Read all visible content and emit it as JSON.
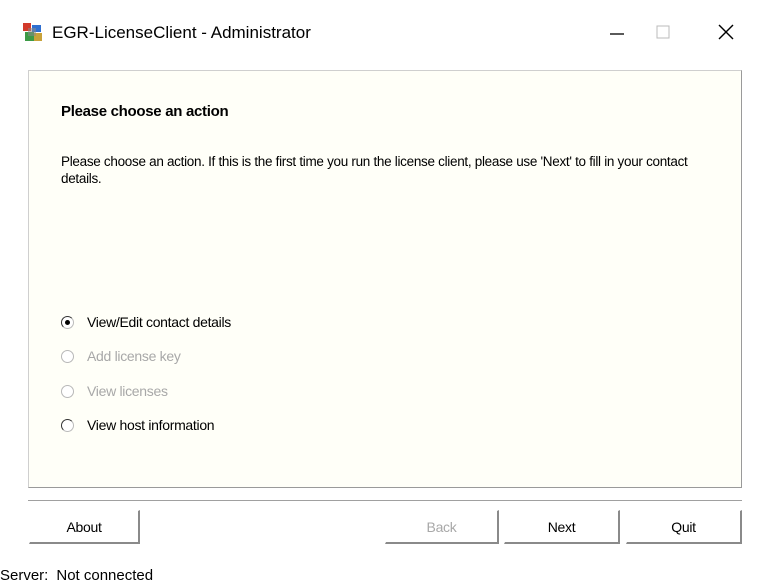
{
  "window": {
    "title": "EGR-LicenseClient - Administrator",
    "app_icon": "egr-license-client-icon",
    "controls": {
      "minimize": "minimize-icon",
      "maximize": "maximize-icon",
      "close": "close-icon"
    }
  },
  "panel": {
    "heading": "Please choose an action",
    "description": "Please choose an action. If this is the first time you run the license client, please use 'Next' to fill in your contact details.",
    "options": [
      {
        "label": "View/Edit contact details",
        "checked": true,
        "enabled": true
      },
      {
        "label": "Add license key",
        "checked": false,
        "enabled": false
      },
      {
        "label": "View licenses",
        "checked": false,
        "enabled": false
      },
      {
        "label": "View host information",
        "checked": false,
        "enabled": true
      }
    ]
  },
  "buttons": {
    "about": "About",
    "back": "Back",
    "next": "Next",
    "quit": "Quit"
  },
  "status": {
    "label": "Server:",
    "value": "Not connected"
  }
}
